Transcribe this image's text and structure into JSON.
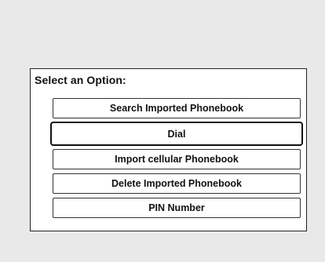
{
  "dialog": {
    "prompt": "Select an Option:",
    "options": [
      {
        "label": "Search Imported Phonebook",
        "selected": false
      },
      {
        "label": "Dial",
        "selected": true
      },
      {
        "label": "Import cellular Phonebook",
        "selected": false
      },
      {
        "label": "Delete Imported Phonebook",
        "selected": false
      },
      {
        "label": "PIN Number",
        "selected": false
      }
    ]
  },
  "colors": {
    "background": "#e9e9ea",
    "panel": "#ffffff",
    "border": "#222222",
    "text": "#111111"
  }
}
